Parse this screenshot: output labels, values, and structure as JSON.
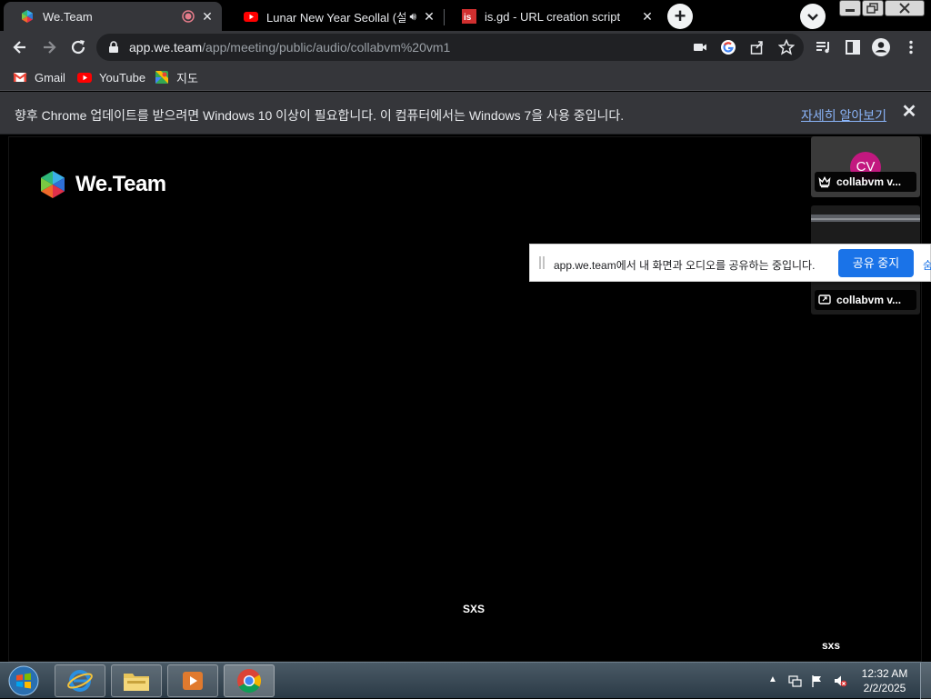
{
  "browser": {
    "tabs": [
      {
        "title": "We.Team",
        "active": true,
        "recording": true
      },
      {
        "title": "Lunar New Year Seollal (설날",
        "audio": true
      },
      {
        "title": "is.gd - URL creation script"
      }
    ],
    "new_tab_label": "+",
    "url_host": "app.we.team",
    "url_path": "/app/meeting/public/audio/collabvm%20vm1",
    "bookmarks": [
      {
        "label": "Gmail",
        "icon": "gmail-icon"
      },
      {
        "label": "YouTube",
        "icon": "youtube-icon"
      },
      {
        "label": "지도",
        "icon": "maps-icon"
      }
    ]
  },
  "infobar": {
    "message": "향후 Chrome 업데이트를 받으려면 Windows 10 이상이 필요합니다. 이 컴퓨터에서는 Windows 7을 사용 중입니다.",
    "link": "자세히 알아보기",
    "close": "✕"
  },
  "page": {
    "brand": "We.Team",
    "participants": [
      {
        "initials": "CV",
        "name": "collabvm v...",
        "role_icon": "crown-icon"
      },
      {
        "name": "collabvm v...",
        "role_icon": "screen-share-icon"
      }
    ],
    "center_label": "SXS",
    "corner_label": "sxs"
  },
  "sharebar": {
    "message": "app.we.team에서 내 화면과 오디오를 공유하는 중입니다.",
    "stop_label": "공유 중지",
    "hide_label": "숨기기"
  },
  "taskbar": {
    "time": "12:32 AM",
    "date": "2/2/2025"
  },
  "colors": {
    "accent": "#1a73e8",
    "avatar": "#c2187f",
    "chrome_dark": "#35363a",
    "link": "#8ab4f8"
  }
}
